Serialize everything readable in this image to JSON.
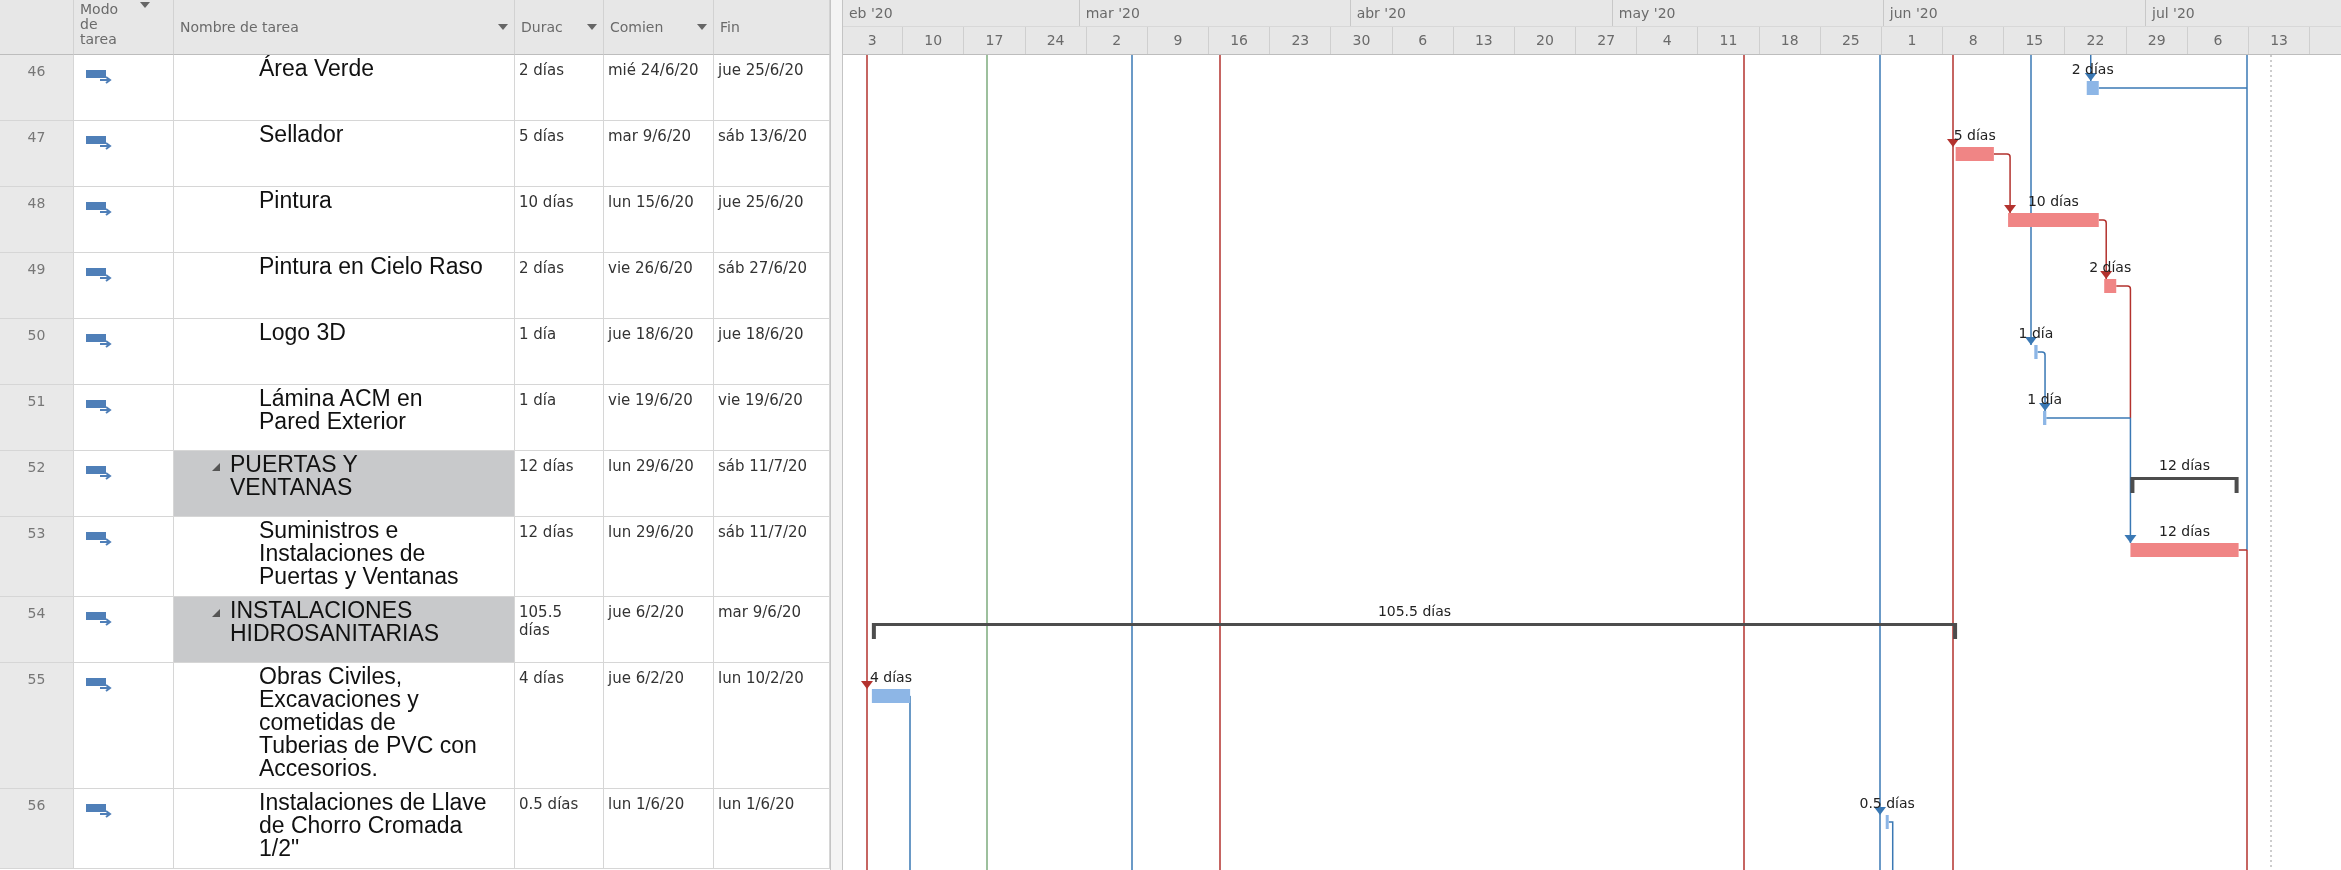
{
  "table": {
    "columns": [
      {
        "label": "Modo de tarea",
        "kind": "mode",
        "filter": true
      },
      {
        "label": "Nombre de tarea",
        "kind": "name",
        "filter": true
      },
      {
        "label": "Durac",
        "kind": "duration",
        "filter": true
      },
      {
        "label": "Comien",
        "kind": "start",
        "filter": true
      },
      {
        "label": "Fin",
        "kind": "finish",
        "filter": false
      }
    ],
    "rows": [
      {
        "id": "46",
        "name": "Área Verde",
        "summary": false,
        "duration": "2 días",
        "start": "mié 24/6/20",
        "finish": "jue 25/6/20"
      },
      {
        "id": "47",
        "name": "Sellador",
        "summary": false,
        "duration": "5 días",
        "start": "mar 9/6/20",
        "finish": "sáb 13/6/20"
      },
      {
        "id": "48",
        "name": "Pintura",
        "summary": false,
        "duration": "10 días",
        "start": "lun 15/6/20",
        "finish": "jue 25/6/20"
      },
      {
        "id": "49",
        "name": "Pintura en Cielo Raso",
        "summary": false,
        "duration": "2 días",
        "start": "vie 26/6/20",
        "finish": "sáb 27/6/20"
      },
      {
        "id": "50",
        "name": "Logo 3D",
        "summary": false,
        "duration": "1 día",
        "start": "jue 18/6/20",
        "finish": "jue 18/6/20"
      },
      {
        "id": "51",
        "name": "Lámina ACM en Pared Exterior",
        "summary": false,
        "duration": "1 día",
        "start": "vie 19/6/20",
        "finish": "vie 19/6/20"
      },
      {
        "id": "52",
        "name": "PUERTAS Y VENTANAS",
        "summary": true,
        "duration": "12 días",
        "start": "lun 29/6/20",
        "finish": "sáb 11/7/20"
      },
      {
        "id": "53",
        "name": "Suministros e Instalaciones de Puertas y Ventanas",
        "summary": false,
        "duration": "12 días",
        "start": "lun 29/6/20",
        "finish": "sáb 11/7/20"
      },
      {
        "id": "54",
        "name": "INSTALACIONES HIDROSANITARIAS",
        "summary": true,
        "duration": "105.5 días",
        "start": "jue 6/2/20",
        "finish": "mar 9/6/20"
      },
      {
        "id": "55",
        "name": "Obras Civiles, Excavaciones y cometidas de Tuberias de PVC con Accesorios.",
        "summary": false,
        "duration": "4 días",
        "start": "jue 6/2/20",
        "finish": "lun 10/2/20"
      },
      {
        "id": "56",
        "name": "Instalaciones de Llave de Chorro Cromada 1/2\"",
        "summary": false,
        "duration": "0.5 días",
        "start": "lun 1/6/20",
        "finish": "lun 1/6/20"
      }
    ]
  },
  "timeline": {
    "months": [
      "eb '20",
      "mar '20",
      "abr '20",
      "may '20",
      "jun '20",
      "jul '20"
    ],
    "weeks": [
      "3",
      "10",
      "17",
      "24",
      "2",
      "9",
      "16",
      "23",
      "30",
      "6",
      "13",
      "20",
      "27",
      "4",
      "11",
      "18",
      "25",
      "1",
      "8",
      "15",
      "22",
      "29",
      "6",
      "13"
    ]
  },
  "gantt": {
    "bars": [
      {
        "label": "2 días",
        "kind": "task",
        "critical": false
      },
      {
        "label": "5 días",
        "kind": "task",
        "critical": true
      },
      {
        "label": "10 días",
        "kind": "task",
        "critical": true
      },
      {
        "label": "2 días",
        "kind": "task",
        "critical": true
      },
      {
        "label": "1 día",
        "kind": "task",
        "critical": false
      },
      {
        "label": "1 día",
        "kind": "task",
        "critical": false
      },
      {
        "label": "12 días",
        "kind": "summary",
        "critical": false
      },
      {
        "label": "12 días",
        "kind": "task",
        "critical": true
      },
      {
        "label": "105.5 días",
        "kind": "summary",
        "critical": false
      },
      {
        "label": "4 días",
        "kind": "task",
        "critical": false
      },
      {
        "label": "0.5 días",
        "kind": "task",
        "critical": false
      }
    ]
  }
}
